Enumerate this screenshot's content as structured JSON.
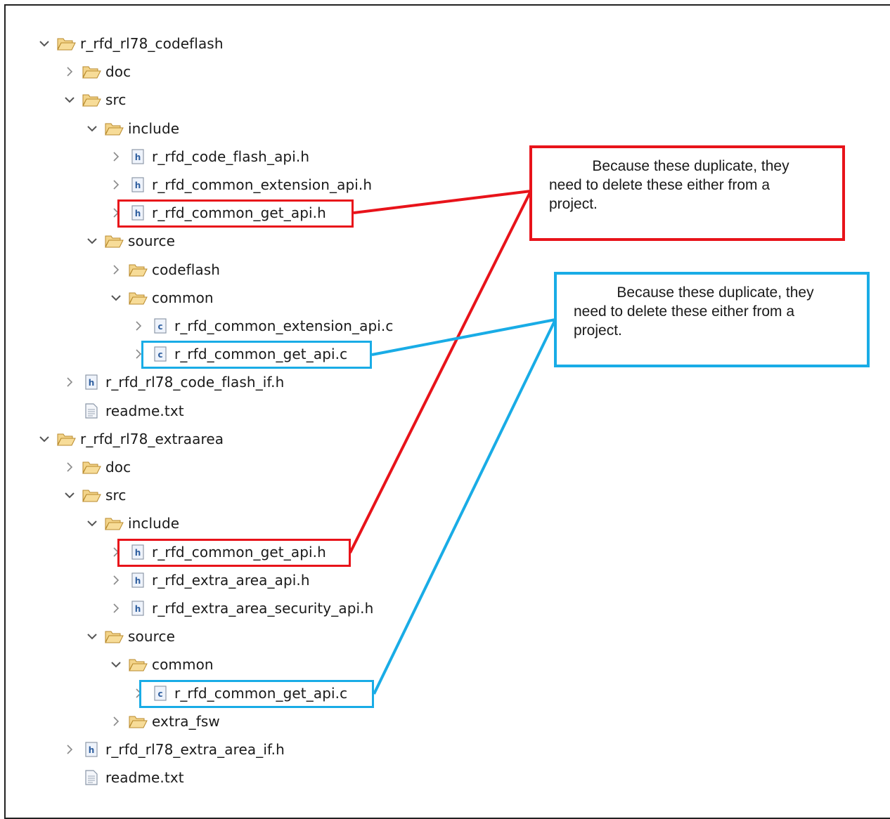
{
  "tree": [
    {
      "label": "r_rfd_rl78_codeflash",
      "type": "folder",
      "state": "expanded"
    },
    {
      "label": "doc",
      "type": "folder",
      "state": "collapsed"
    },
    {
      "label": "src",
      "type": "folder",
      "state": "expanded"
    },
    {
      "label": "include",
      "type": "folder",
      "state": "expanded"
    },
    {
      "label": "r_rfd_code_flash_api.h",
      "type": "h-file",
      "state": "collapsed"
    },
    {
      "label": "r_rfd_common_extension_api.h",
      "type": "h-file",
      "state": "collapsed"
    },
    {
      "label": "r_rfd_common_get_api.h",
      "type": "h-file",
      "state": "collapsed"
    },
    {
      "label": "source",
      "type": "folder",
      "state": "expanded"
    },
    {
      "label": "codeflash",
      "type": "folder",
      "state": "collapsed"
    },
    {
      "label": "common",
      "type": "folder",
      "state": "expanded"
    },
    {
      "label": "r_rfd_common_extension_api.c",
      "type": "c-file",
      "state": "collapsed"
    },
    {
      "label": "r_rfd_common_get_api.c",
      "type": "c-file",
      "state": "collapsed"
    },
    {
      "label": "r_rfd_rl78_code_flash_if.h",
      "type": "h-file",
      "state": "collapsed"
    },
    {
      "label": "readme.txt",
      "type": "txt-file",
      "state": "none"
    },
    {
      "label": "r_rfd_rl78_extraarea",
      "type": "folder",
      "state": "expanded"
    },
    {
      "label": "doc",
      "type": "folder",
      "state": "collapsed"
    },
    {
      "label": "src",
      "type": "folder",
      "state": "expanded"
    },
    {
      "label": "include",
      "type": "folder",
      "state": "expanded"
    },
    {
      "label": "r_rfd_common_get_api.h",
      "type": "h-file",
      "state": "collapsed"
    },
    {
      "label": "r_rfd_extra_area_api.h",
      "type": "h-file",
      "state": "collapsed"
    },
    {
      "label": "r_rfd_extra_area_security_api.h",
      "type": "h-file",
      "state": "collapsed"
    },
    {
      "label": "source",
      "type": "folder",
      "state": "expanded"
    },
    {
      "label": "common",
      "type": "folder",
      "state": "expanded"
    },
    {
      "label": "r_rfd_common_get_api.c",
      "type": "c-file",
      "state": "collapsed"
    },
    {
      "label": "extra_fsw",
      "type": "folder",
      "state": "collapsed"
    },
    {
      "label": "r_rfd_rl78_extra_area_if.h",
      "type": "h-file",
      "state": "collapsed"
    },
    {
      "label": "readme.txt",
      "type": "txt-file",
      "state": "none"
    }
  ],
  "callouts": {
    "red": {
      "line1": "Because these duplicate, they",
      "line2": "need to delete these either from a",
      "line3": "project."
    },
    "blue": {
      "line1": "Because these duplicate, they",
      "line2": "need to delete these either from a",
      "line3": "project."
    }
  },
  "colors": {
    "highlight_red": "#e8131a",
    "highlight_blue": "#19ace6",
    "folder": "#e8c06a",
    "h_icon": "#3a6fb5",
    "c_icon": "#3a6fb5"
  },
  "icons": {
    "expanded": "chevron-down-icon",
    "collapsed": "chevron-right-icon",
    "folder": "folder-open-icon",
    "h-file": "header-file-icon",
    "c-file": "c-source-file-icon",
    "txt-file": "text-file-icon"
  }
}
